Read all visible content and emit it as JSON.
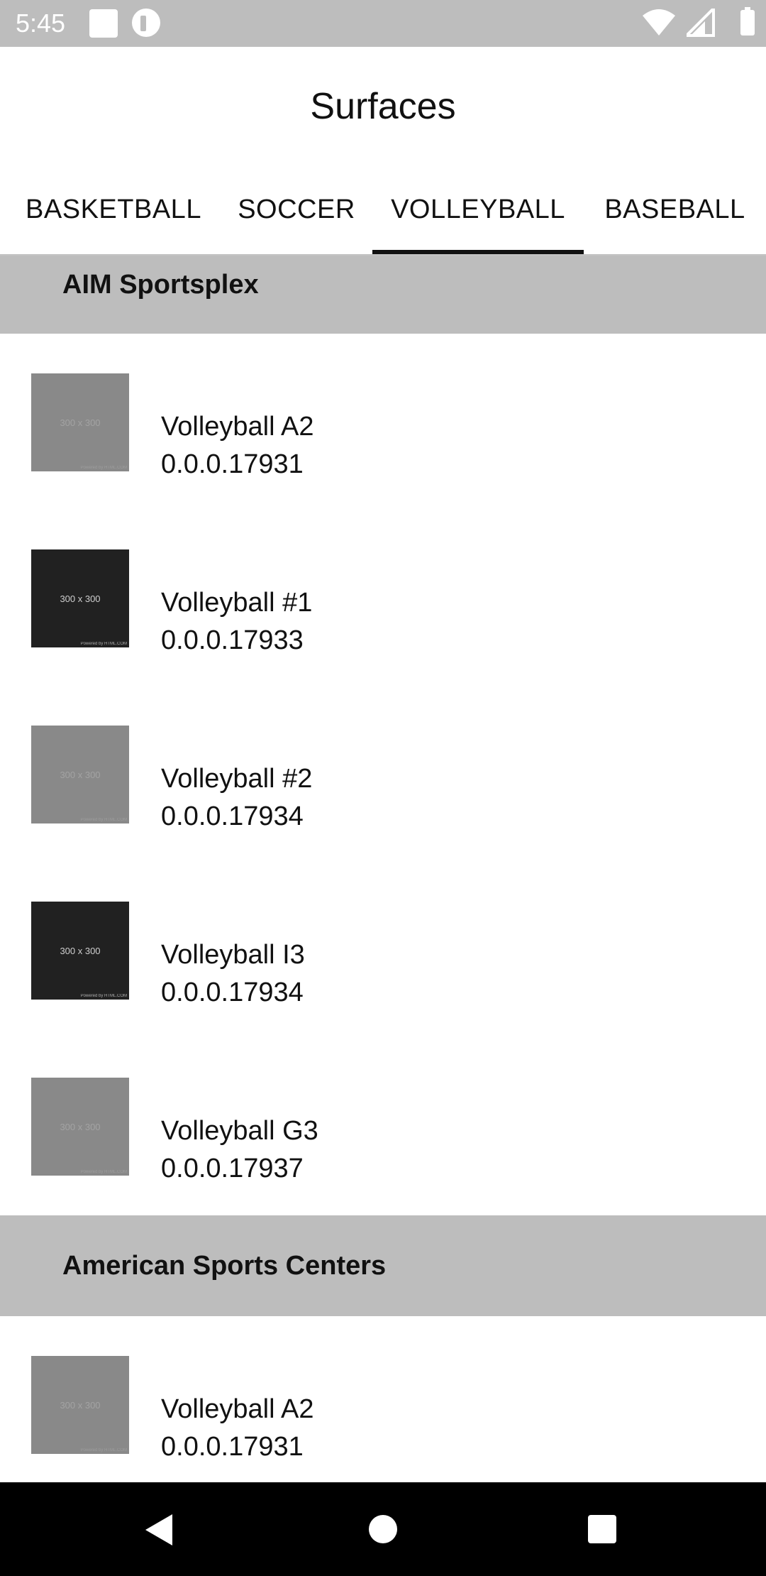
{
  "status_bar": {
    "time": "5:45",
    "icons": [
      "notification-square-icon",
      "notification-circle-icon",
      "wifi-icon",
      "cell-signal-icon",
      "battery-icon"
    ],
    "background": "#bdbdbd"
  },
  "header": {
    "title": "Surfaces"
  },
  "tabs": [
    {
      "label": "BASKETBALL",
      "selected": false
    },
    {
      "label": "SOCCER",
      "selected": false
    },
    {
      "label": "VOLLEYBALL",
      "selected": true
    },
    {
      "label": "BASEBALL",
      "selected": false
    }
  ],
  "sections": [
    {
      "title": "AIM Sportsplex",
      "items": [
        {
          "name": "Volleyball A2",
          "version": "0.0.0.17931",
          "thumb_text": "300 x 300",
          "thumb_style": "light"
        },
        {
          "name": "Volleyball #1",
          "version": "0.0.0.17933",
          "thumb_text": "300 x 300",
          "thumb_style": "dark"
        },
        {
          "name": "Volleyball #2",
          "version": "0.0.0.17934",
          "thumb_text": "300 x 300",
          "thumb_style": "light"
        },
        {
          "name": "Volleyball I3",
          "version": "0.0.0.17934",
          "thumb_text": "300 x 300",
          "thumb_style": "dark"
        },
        {
          "name": "Volleyball G3",
          "version": "0.0.0.17937",
          "thumb_text": "300 x 300",
          "thumb_style": "light"
        }
      ]
    },
    {
      "title": "American Sports Centers",
      "items": [
        {
          "name": "Volleyball A2",
          "version": "0.0.0.17931",
          "thumb_text": "300 x 300",
          "thumb_style": "light"
        }
      ]
    }
  ],
  "thumb_footer": "Powered by HTML.COM",
  "nav_bar": {
    "buttons": [
      "back-icon",
      "home-icon",
      "recents-icon"
    ]
  },
  "colors": {
    "section_header_bg": "#bdbdbd",
    "tab_indicator": "#111111",
    "thumb_light": "#898989",
    "thumb_dark": "#212121"
  }
}
